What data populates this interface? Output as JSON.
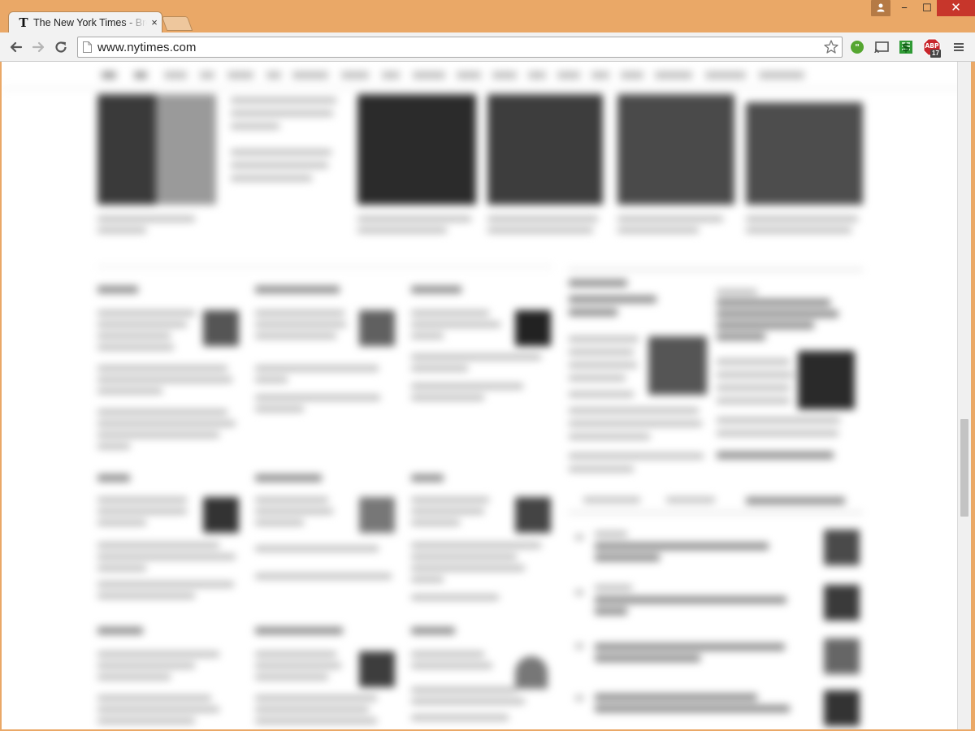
{
  "window": {
    "tab": {
      "title": "The New York Times - Breaking News, World News & Multimedia",
      "favicon_glyph": "T",
      "close_glyph": "×"
    },
    "controls": {
      "minimize_glyph": "−",
      "maximize_glyph": "☐",
      "close_glyph": "✕"
    }
  },
  "toolbar": {
    "url": "www.nytimes.com",
    "icons": [
      "back-icon",
      "forward-icon",
      "reload-icon",
      "page-icon",
      "star-icon",
      "evernote-icon",
      "cast-icon",
      "dollar-extension-icon",
      "adblock-plus-icon",
      "menu-icon"
    ],
    "abp_label": "ABP",
    "abp_count": "17"
  },
  "colors": {
    "frame": "#eaa867",
    "close_button": "#c7362b",
    "toolbar": "#f2f2f2",
    "abp_red": "#c8262c",
    "evernote_green": "#55a630",
    "dollar_green": "#2f9a35"
  }
}
